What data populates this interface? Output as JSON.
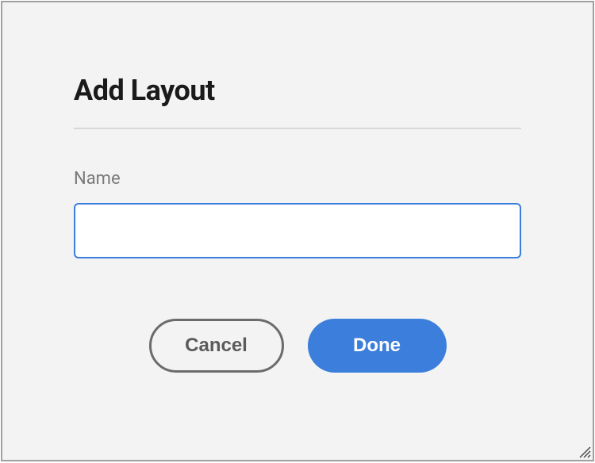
{
  "dialog": {
    "title": "Add Layout",
    "fields": {
      "name": {
        "label": "Name",
        "value": "",
        "placeholder": ""
      }
    },
    "buttons": {
      "cancel_label": "Cancel",
      "done_label": "Done"
    }
  }
}
